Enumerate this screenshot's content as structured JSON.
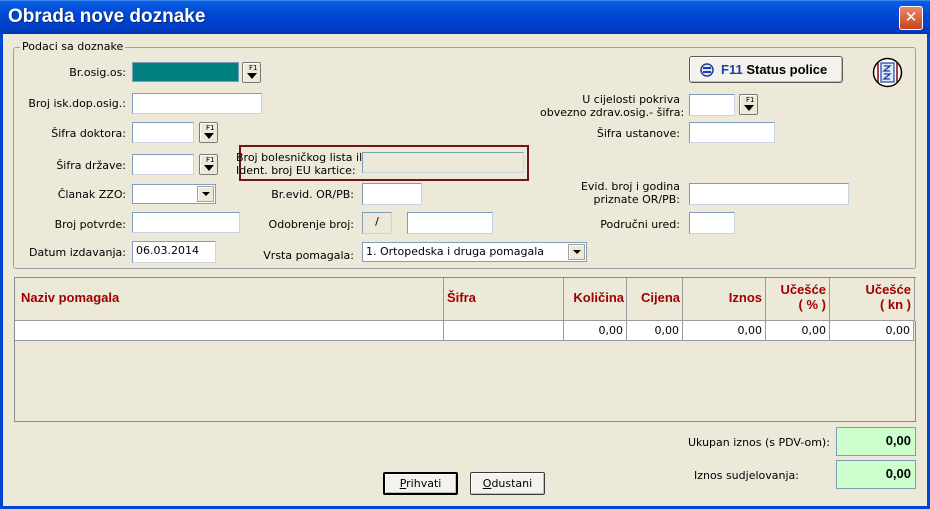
{
  "window": {
    "title": "Obrada nove doznake",
    "close_symbol": "✕"
  },
  "group_title": "Podaci sa doznake",
  "status_button": {
    "key": "F11",
    "label": "Status police"
  },
  "fields": {
    "broj_osig_os": {
      "label": "Br.osig.os:",
      "value": ""
    },
    "broj_isk_dop_osig": {
      "label": "Broj isk.dop.osig.:",
      "value": ""
    },
    "sifra_doktora": {
      "label": "Šifra doktora:",
      "value": ""
    },
    "sifra_drzave": {
      "label": "Šifra države:",
      "value": ""
    },
    "clanak_zzo": {
      "label": "Članak ZZO:",
      "value": ""
    },
    "broj_potvrde": {
      "label": "Broj potvrde:",
      "value": ""
    },
    "datum_izdavanja": {
      "label": "Datum izdavanja:",
      "value": "06.03.2014"
    },
    "broj_bolesnickog_1": "Broj bolesničkog lista ili",
    "broj_bolesnickog_2": "Ident. broj EU kartice:",
    "broj_bolesnickog_value": "",
    "br_evid_or_pb": {
      "label": "Br.evid. OR/PB:",
      "value": ""
    },
    "odobrenje_broj": {
      "label": "Odobrenje broj:",
      "sep": "/",
      "value": ""
    },
    "vrsta_pomagala": {
      "label": "Vrsta pomagala:",
      "value": "1. Ortopedska i druga pomagala"
    },
    "u_cijelosti_1": "U cijelosti pokriva",
    "u_cijelosti_2": "obvezno zdrav.osig.- šifra:",
    "u_cijelosti_value": "",
    "sifra_ustanove": {
      "label": "Šifra ustanove:",
      "value": ""
    },
    "evid_broj_1": "Evid. broj i godina",
    "evid_broj_2": "priznate OR/PB:",
    "evid_broj_value": "",
    "podrucni_ured": {
      "label": "Područni ured:",
      "value": ""
    }
  },
  "f1_label": "F1",
  "table": {
    "headers": {
      "naziv": "Naziv pomagala",
      "sifra": "Šifra",
      "kolicina": "Količina",
      "cijena": "Cijena",
      "iznos": "Iznos",
      "ucesce_pct_1": "Učešće",
      "ucesce_pct_2": "( % )",
      "ucesce_kn_1": "Učešće",
      "ucesce_kn_2": "( kn )"
    },
    "row": {
      "naziv": "",
      "sifra": "",
      "kolicina": "0,00",
      "cijena": "0,00",
      "iznos": "0,00",
      "ucesce_pct": "0,00",
      "ucesce_kn": "0,00"
    }
  },
  "totals": {
    "ukupan_label": "Ukupan iznos (s PDV-om):",
    "ukupan_value": "0,00",
    "sudjelovanje_label": "Iznos sudjelovanja:",
    "sudjelovanje_value": "0,00"
  },
  "buttons": {
    "prihvati_u": "P",
    "prihvati_rest": "rihvati",
    "odustani_u": "O",
    "odustani_rest": "dustani"
  },
  "colors": {
    "title_blue": "#0046d5",
    "header_red": "#a00000",
    "teal": "#008080",
    "total_green": "#ccffcc",
    "frame_border": "#6e1515"
  }
}
